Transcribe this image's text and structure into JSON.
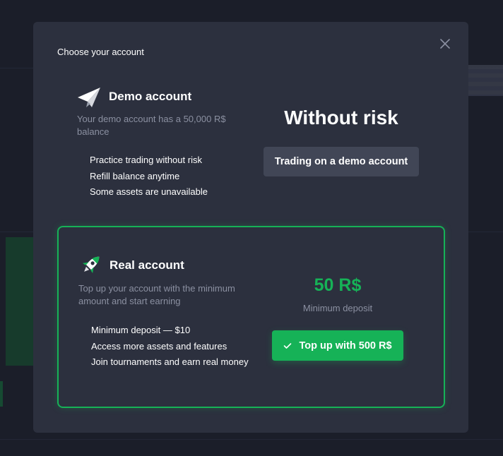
{
  "modal": {
    "title": "Choose your account",
    "close_icon": "close-icon"
  },
  "demo": {
    "icon": "paper-plane-icon",
    "title": "Demo account",
    "description": "Your demo account has a 50,000 R$ balance",
    "features": [
      "Practice trading without risk",
      "Refill balance anytime",
      "Some assets are unavailable"
    ],
    "headline": "Without risk",
    "button_label": "Trading on a demo account"
  },
  "real": {
    "icon": "rocket-icon",
    "title": "Real account",
    "description": "Top up your account with the minimum amount and start earning",
    "features": [
      "Minimum deposit — $10",
      "Access more assets and features",
      "Join tournaments and earn real money"
    ],
    "amount": "50 R$",
    "amount_caption": "Minimum deposit",
    "button_icon": "check-icon",
    "button_label": "Top up with 500 R$"
  },
  "colors": {
    "accent_green": "#16b257",
    "modal_bg": "#2c303e",
    "muted_text": "#8b90a1",
    "demo_button_bg": "#414656"
  }
}
